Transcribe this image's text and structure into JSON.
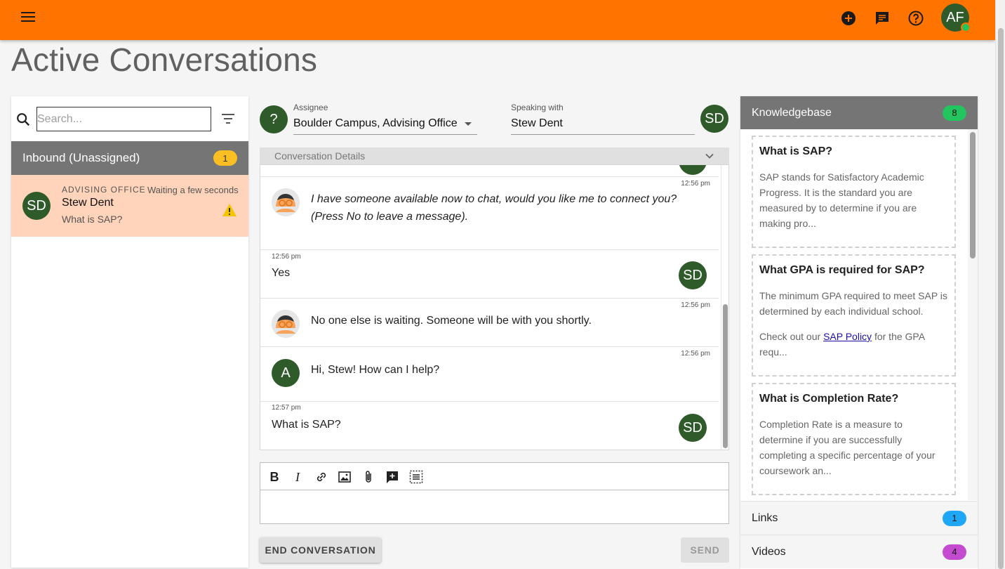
{
  "topbar": {
    "menu_icon": "menu-icon",
    "icons": [
      "add-circle-icon",
      "chat-icon",
      "help-icon"
    ],
    "user_initials": "AF",
    "accent": "#ff7300"
  },
  "page": {
    "title": "Active Conversations"
  },
  "left": {
    "search_placeholder": "Search...",
    "inbound": {
      "label": "Inbound (Unassigned)",
      "count": "1"
    },
    "conversation": {
      "initials": "SD",
      "office": "ADVISING OFFICE",
      "waiting": "Waiting a few seconds",
      "name": "Stew Dent",
      "preview": "What is SAP?"
    }
  },
  "middle": {
    "assignee_initials": "?",
    "assignee_label": "Assignee",
    "assignee_value": "Boulder Campus, Advising Office",
    "speaking_label": "Speaking with",
    "speaking_value": "Stew Dent",
    "speaking_initials": "SD",
    "details_label": "Conversation Details",
    "messages": [
      {
        "time": "12:56 pm",
        "text": "I have someone available now to chat, would you like me to connect you? (Press No to leave a message)."
      },
      {
        "time": "12:56 pm",
        "text": "Yes",
        "initials": "SD"
      },
      {
        "time": "12:56 pm",
        "text": "No one else is waiting. Someone will be with you shortly."
      },
      {
        "time": "12:56 pm",
        "text": "Hi, Stew! How can I help?",
        "initials": "A"
      },
      {
        "time": "12:57 pm",
        "text": "What is SAP?",
        "initials": "SD"
      }
    ],
    "toolbar": [
      "bold-icon",
      "italic-icon",
      "link-icon",
      "image-icon",
      "attachment-icon",
      "add-comment-icon",
      "select-area-icon"
    ],
    "end_label": "END CONVERSATION",
    "send_label": "SEND"
  },
  "right": {
    "kb": {
      "label": "Knowledgebase",
      "count": "8"
    },
    "cards": [
      {
        "title": "What is SAP?",
        "body": "SAP stands for Satisfactory Academic Progress. It is the standard you are measured by to determine if you are making pro..."
      },
      {
        "title": "What GPA is required for SAP?",
        "body": "The minimum GPA required to meet SAP is determined by each individual school.",
        "body2_pre": "Check out our ",
        "body2_link": "SAP Policy",
        "body2_post": " for the GPA requ..."
      },
      {
        "title": "What is Completion Rate?",
        "body": "Completion Rate is a measure to determine if you are successfully completing a specific percentage of your coursework an..."
      }
    ],
    "links": {
      "label": "Links",
      "count": "1"
    },
    "videos": {
      "label": "Videos",
      "count": "4"
    }
  }
}
